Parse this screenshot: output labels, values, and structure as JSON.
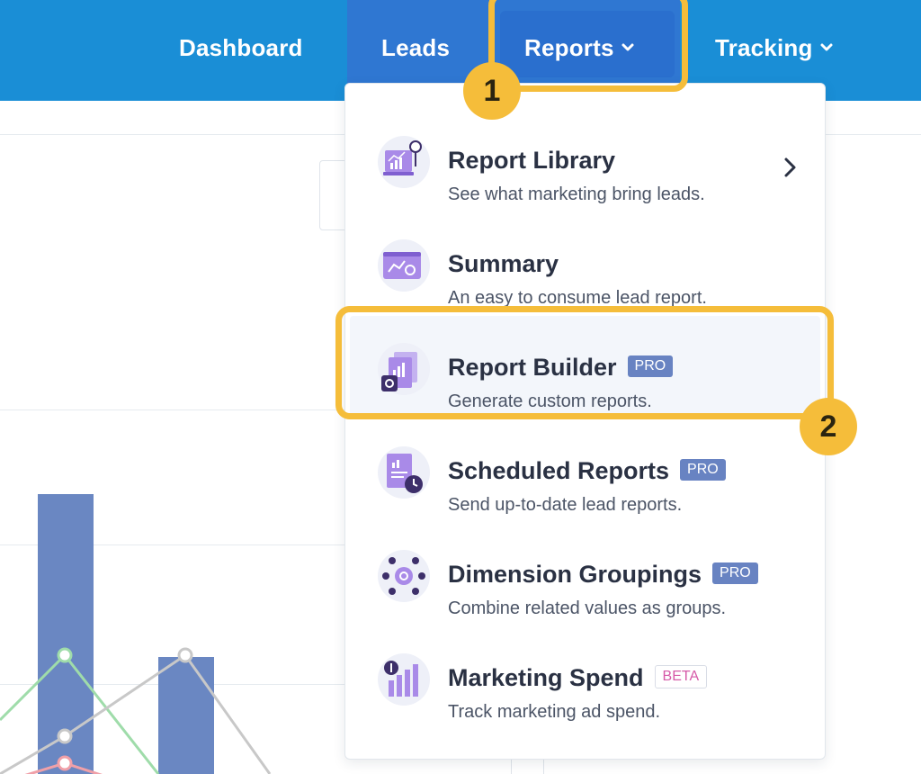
{
  "nav": {
    "items": [
      {
        "label": "Dashboard"
      },
      {
        "label": "Leads"
      },
      {
        "label": "Reports"
      },
      {
        "label": "Tracking"
      }
    ]
  },
  "menu": {
    "items": [
      {
        "title": "Report Library",
        "description": "See what marketing bring leads.",
        "icon": "report-library-icon",
        "has_submenu": true
      },
      {
        "title": "Summary",
        "description": "An easy to consume lead report.",
        "icon": "summary-icon"
      },
      {
        "title": "Report Builder",
        "description": "Generate custom reports.",
        "badge": "PRO",
        "icon": "report-builder-icon"
      },
      {
        "title": "Scheduled Reports",
        "description": "Send up-to-date lead reports.",
        "badge": "PRO",
        "icon": "scheduled-reports-icon"
      },
      {
        "title": "Dimension Groupings",
        "description": "Combine related values as groups.",
        "badge": "PRO",
        "icon": "dimension-groupings-icon"
      },
      {
        "title": "Marketing Spend",
        "description": "Track marketing ad spend.",
        "badge": "BETA",
        "icon": "marketing-spend-icon"
      }
    ]
  },
  "annotations": {
    "step_1": "1",
    "step_2": "2"
  },
  "colors": {
    "nav_bg": "#1a8ed6",
    "nav_active": "#2f77d2",
    "highlight": "#f5bd3a",
    "badge_pro": "#6883c2",
    "badge_beta_text": "#d65aa8"
  }
}
